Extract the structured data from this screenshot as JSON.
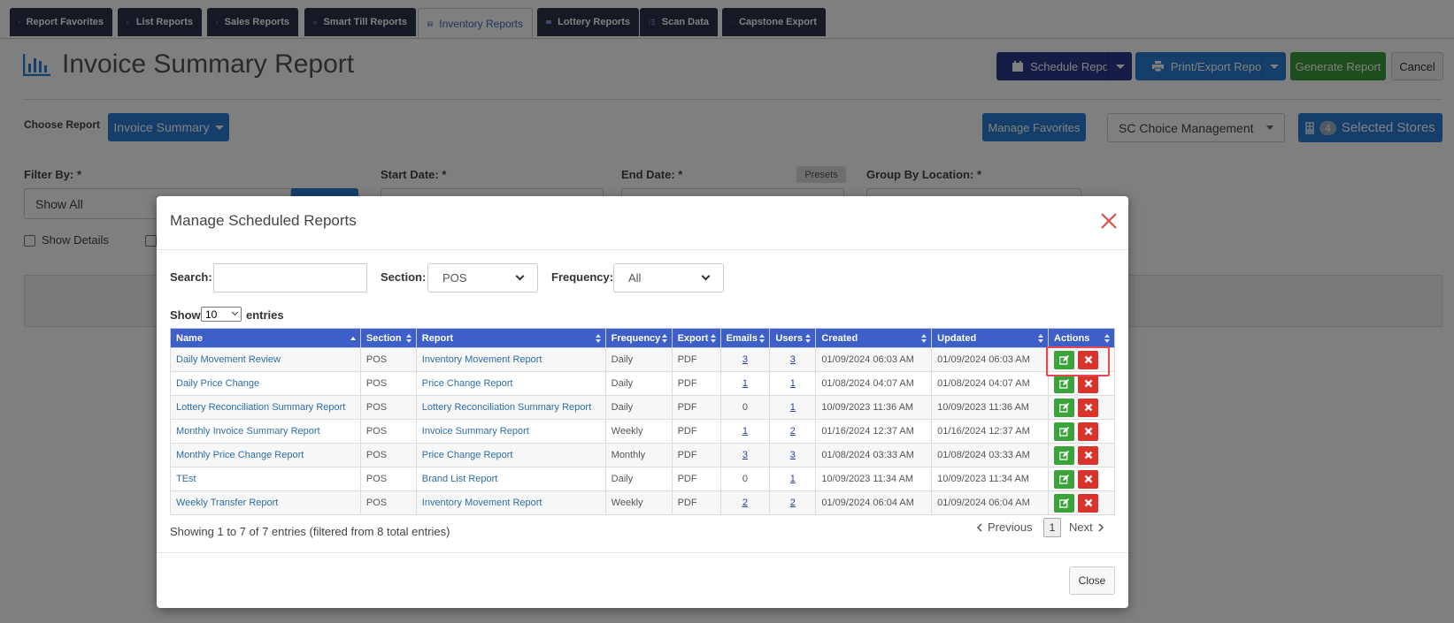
{
  "tabs": [
    {
      "label": "Report Favorites",
      "icon": "bookmark-icon",
      "active": false
    },
    {
      "label": "List Reports",
      "icon": "line-chart-icon",
      "active": false
    },
    {
      "label": "Sales Reports",
      "icon": "line-chart-icon",
      "active": false
    },
    {
      "label": "Smart Till Reports",
      "icon": "line-chart-icon",
      "active": false
    },
    {
      "label": "Inventory Reports",
      "icon": "inventory-icon",
      "active": true
    },
    {
      "label": "Lottery Reports",
      "icon": "ticket-icon",
      "active": false
    },
    {
      "label": "Scan Data",
      "icon": "barcode-icon",
      "active": false
    },
    {
      "label": "Capstone Export",
      "icon": "gears-icon",
      "active": false
    }
  ],
  "page": {
    "title": "Invoice Summary Report",
    "buttons": {
      "schedule": "Schedule Report",
      "print_export": "Print/Export Report",
      "generate": "Generate Report",
      "cancel": "Cancel"
    },
    "choose_report_label": "Choose Report",
    "choose_report_value": "Invoice Summary",
    "manage_favorites": "Manage Favorites",
    "management": "SC Choice Management",
    "stores_count": "4",
    "stores_label": "Selected Stores",
    "filter_by_label": "Filter By: *",
    "filter_by_value": "Show All",
    "start_date_label": "Start Date: *",
    "end_date_label": "End Date: *",
    "presets": "Presets",
    "group_by_label": "Group By Location: *",
    "show_details": "Show Details"
  },
  "modal": {
    "title": "Manage Scheduled Reports",
    "search_label": "Search:",
    "search_value": "",
    "section_label": "Section:",
    "section_value": "POS",
    "frequency_label": "Frequency:",
    "frequency_value": "All",
    "show_label": "Show",
    "entries_value": "10",
    "entries_label": "entries",
    "columns": [
      "Name",
      "Section",
      "Report",
      "Frequency",
      "Export",
      "Emails",
      "Users",
      "Created",
      "Updated",
      "Actions"
    ],
    "rows": [
      {
        "name": "Daily Movement Review",
        "section": "POS",
        "report": "Inventory Movement Report",
        "frequency": "Daily",
        "export": "PDF",
        "emails": "3",
        "users": "3",
        "created": "01/09/2024 06:03 AM",
        "updated": "01/09/2024 06:03 AM"
      },
      {
        "name": "Daily Price Change",
        "section": "POS",
        "report": "Price Change Report",
        "frequency": "Daily",
        "export": "PDF",
        "emails": "1",
        "users": "1",
        "created": "01/08/2024 04:07 AM",
        "updated": "01/08/2024 04:07 AM"
      },
      {
        "name": "Lottery Reconciliation Summary Report",
        "section": "POS",
        "report": "Lottery Reconciliation Summary Report",
        "frequency": "Daily",
        "export": "PDF",
        "emails": "0",
        "users": "1",
        "created": "10/09/2023 11:36 AM",
        "updated": "10/09/2023 11:36 AM"
      },
      {
        "name": "Monthly Invoice Summary Report",
        "section": "POS",
        "report": "Invoice Summary Report",
        "frequency": "Weekly",
        "export": "PDF",
        "emails": "1",
        "users": "2",
        "created": "01/16/2024 12:37 AM",
        "updated": "01/16/2024 12:37 AM"
      },
      {
        "name": "Monthly Price Change Report",
        "section": "POS",
        "report": "Price Change Report",
        "frequency": "Monthly",
        "export": "PDF",
        "emails": "3",
        "users": "3",
        "created": "01/08/2024 03:33 AM",
        "updated": "01/08/2024 03:33 AM"
      },
      {
        "name": "TEst",
        "section": "POS",
        "report": "Brand List Report",
        "frequency": "Daily",
        "export": "PDF",
        "emails": "0",
        "users": "1",
        "created": "10/09/2023 11:34 AM",
        "updated": "10/09/2023 11:34 AM"
      },
      {
        "name": "Weekly Transfer Report",
        "section": "POS",
        "report": "Inventory Movement Report",
        "frequency": "Weekly",
        "export": "PDF",
        "emails": "2",
        "users": "2",
        "created": "01/09/2024 06:04 AM",
        "updated": "01/09/2024 06:04 AM"
      }
    ],
    "summary": "Showing 1 to 7 of 7 entries (filtered from 8 total entries)",
    "previous": "Previous",
    "page_number": "1",
    "next": "Next",
    "close": "Close"
  },
  "colors": {
    "tab_bg": "#2b3249",
    "table_header": "#3d5fc7",
    "edit_green": "#3aa33a",
    "delete_red": "#d9332b",
    "highlight": "#e8474f"
  }
}
